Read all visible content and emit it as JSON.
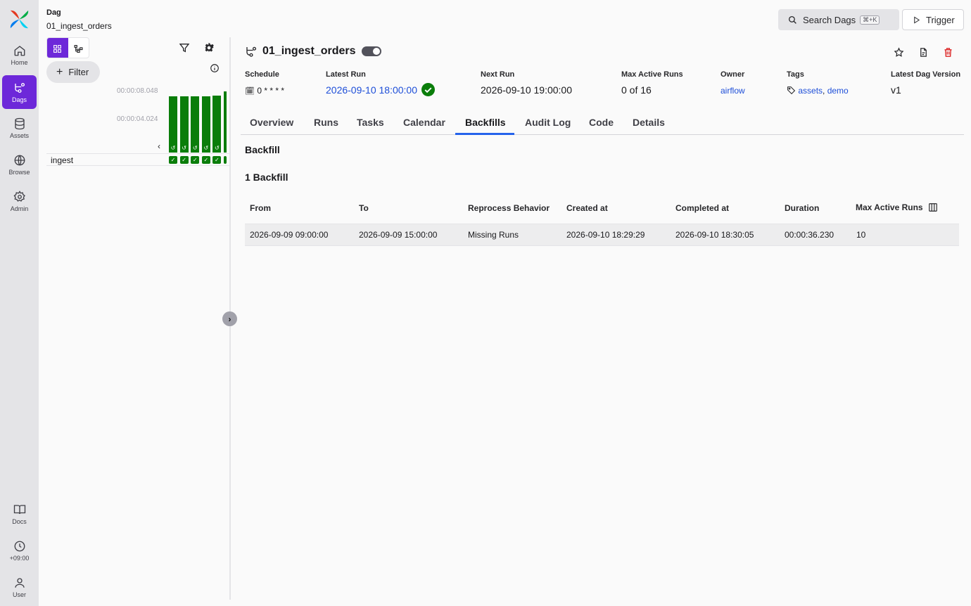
{
  "nav": {
    "items": [
      {
        "label": "Home",
        "icon": "home-icon"
      },
      {
        "label": "Dags",
        "icon": "dags-icon",
        "active": true
      },
      {
        "label": "Assets",
        "icon": "database-icon"
      },
      {
        "label": "Browse",
        "icon": "globe-icon"
      },
      {
        "label": "Admin",
        "icon": "gear-icon"
      }
    ],
    "bottom": [
      {
        "label": "Docs",
        "icon": "book-icon"
      },
      {
        "label": "+09:00",
        "icon": "clock-icon"
      },
      {
        "label": "User",
        "icon": "user-icon"
      }
    ]
  },
  "breadcrumb": {
    "section": "Dag",
    "name": "01_ingest_orders"
  },
  "search": {
    "label": "Search Dags",
    "shortcut": "⌘+K"
  },
  "trigger": {
    "label": "Trigger"
  },
  "left_panel": {
    "filter_label": "Filter",
    "duration_labels": [
      "00:00:08.048",
      "00:00:04.024"
    ],
    "task_name": "ingest",
    "run_bar_fractions": [
      0.92,
      0.92,
      0.92,
      0.92,
      0.93,
      1.0
    ]
  },
  "dag": {
    "title": "01_ingest_orders",
    "paused": false
  },
  "meta": {
    "schedule": {
      "label": "Schedule",
      "value": "0 * * * *"
    },
    "latest_run": {
      "label": "Latest Run",
      "value": "2026-09-10 18:00:00"
    },
    "next_run": {
      "label": "Next Run",
      "value": "2026-09-10 19:00:00"
    },
    "max_active_runs": {
      "label": "Max Active Runs",
      "value": "0 of 16"
    },
    "owner": {
      "label": "Owner",
      "value": "airflow"
    },
    "tags": {
      "label": "Tags",
      "values": [
        "assets",
        "demo"
      ]
    },
    "version": {
      "label": "Latest Dag Version",
      "value": "v1"
    }
  },
  "tabs": [
    "Overview",
    "Runs",
    "Tasks",
    "Calendar",
    "Backfills",
    "Audit Log",
    "Code",
    "Details"
  ],
  "active_tab": "Backfills",
  "backfill": {
    "section_title": "Backfill",
    "count_title": "1 Backfill",
    "columns": [
      "From",
      "To",
      "Reprocess Behavior",
      "Created at",
      "Completed at",
      "Duration",
      "Max Active Runs"
    ],
    "rows": [
      [
        "2026-09-09 09:00:00",
        "2026-09-09 15:00:00",
        "Missing Runs",
        "2026-09-10 18:29:29",
        "2026-09-10 18:30:05",
        "00:00:36.230",
        "10"
      ]
    ]
  },
  "colors": {
    "accent": "#6d28d9",
    "success": "#0a7d0a",
    "link": "#1d4ed8",
    "tab_indicator": "#2563eb",
    "danger": "#dc2626"
  }
}
